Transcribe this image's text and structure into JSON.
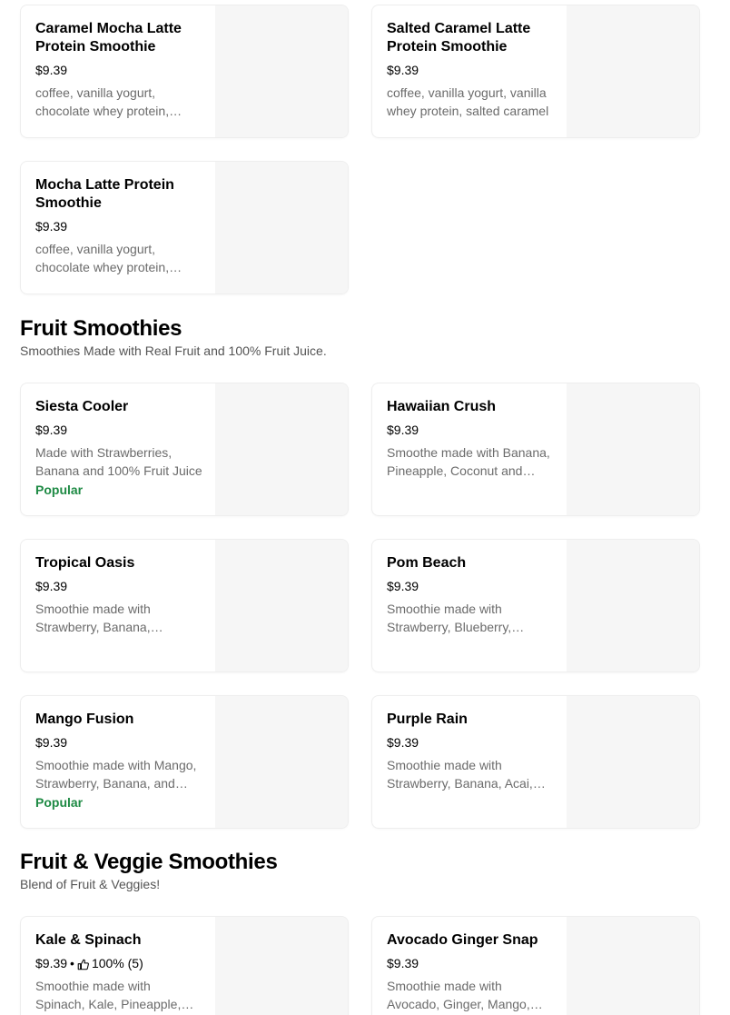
{
  "sections": [
    {
      "title": "",
      "subtitle": "",
      "items": [
        {
          "name": "Caramel Mocha Latte Protein Smoothie",
          "price": "$9.39",
          "desc": "coffee, vanilla yogurt, chocolate whey protein, caramel syrup",
          "badge": ""
        },
        {
          "name": "Salted Caramel Latte Protein Smoothie",
          "price": "$9.39",
          "desc": "coffee, vanilla yogurt, vanilla whey protein, salted caramel",
          "badge": ""
        },
        {
          "name": "Mocha Latte Protein Smoothie",
          "price": "$9.39",
          "desc": "coffee, vanilla yogurt, chocolate whey protein, mocha",
          "badge": ""
        }
      ]
    },
    {
      "title": "Fruit Smoothies",
      "subtitle": "Smoothies Made with Real Fruit and 100% Fruit Juice.",
      "items": [
        {
          "name": "Siesta Cooler",
          "price": "$9.39",
          "desc": "Made with Strawberries, Banana and 100% Fruit Juice",
          "badge": "Popular"
        },
        {
          "name": "Hawaiian Crush",
          "price": "$9.39",
          "desc": "Smoothe made with Banana, Pineapple, Coconut and Mango",
          "badge": ""
        },
        {
          "name": "Tropical Oasis",
          "price": "$9.39",
          "desc": "Smoothie made with Strawberry, Banana, Pineapple and Mango",
          "badge": ""
        },
        {
          "name": "Pom Beach",
          "price": "$9.39",
          "desc": "Smoothie made with Strawberry, Blueberry, Pomegranate",
          "badge": ""
        },
        {
          "name": "Mango Fusion",
          "price": "$9.39",
          "desc": "Smoothie made with Mango, Strawberry, Banana, and Peach",
          "badge": "Popular"
        },
        {
          "name": "Purple Rain",
          "price": "$9.39",
          "desc": "Smoothie made with Strawberry, Banana, Acai, Blueberry",
          "badge": ""
        }
      ]
    },
    {
      "title": "Fruit & Veggie Smoothies",
      "subtitle": "Blend of Fruit & Veggies!",
      "items": [
        {
          "name": "Kale & Spinach",
          "price": "$9.39",
          "separator": "•",
          "rating": "100% (5)",
          "desc": "Smoothie made with Spinach, Kale, Pineapple, Mango",
          "badge": ""
        },
        {
          "name": "Avocado Ginger Snap",
          "price": "$9.39",
          "desc": "Smoothie made with Avocado, Ginger, Mango, Pineapple",
          "badge": ""
        }
      ]
    }
  ],
  "icons": {
    "rating": "thumbs-up-icon"
  },
  "colors": {
    "popular": "#1e8a44",
    "description": "#6b6b6b",
    "thumbnail": "#f6f6f6"
  }
}
